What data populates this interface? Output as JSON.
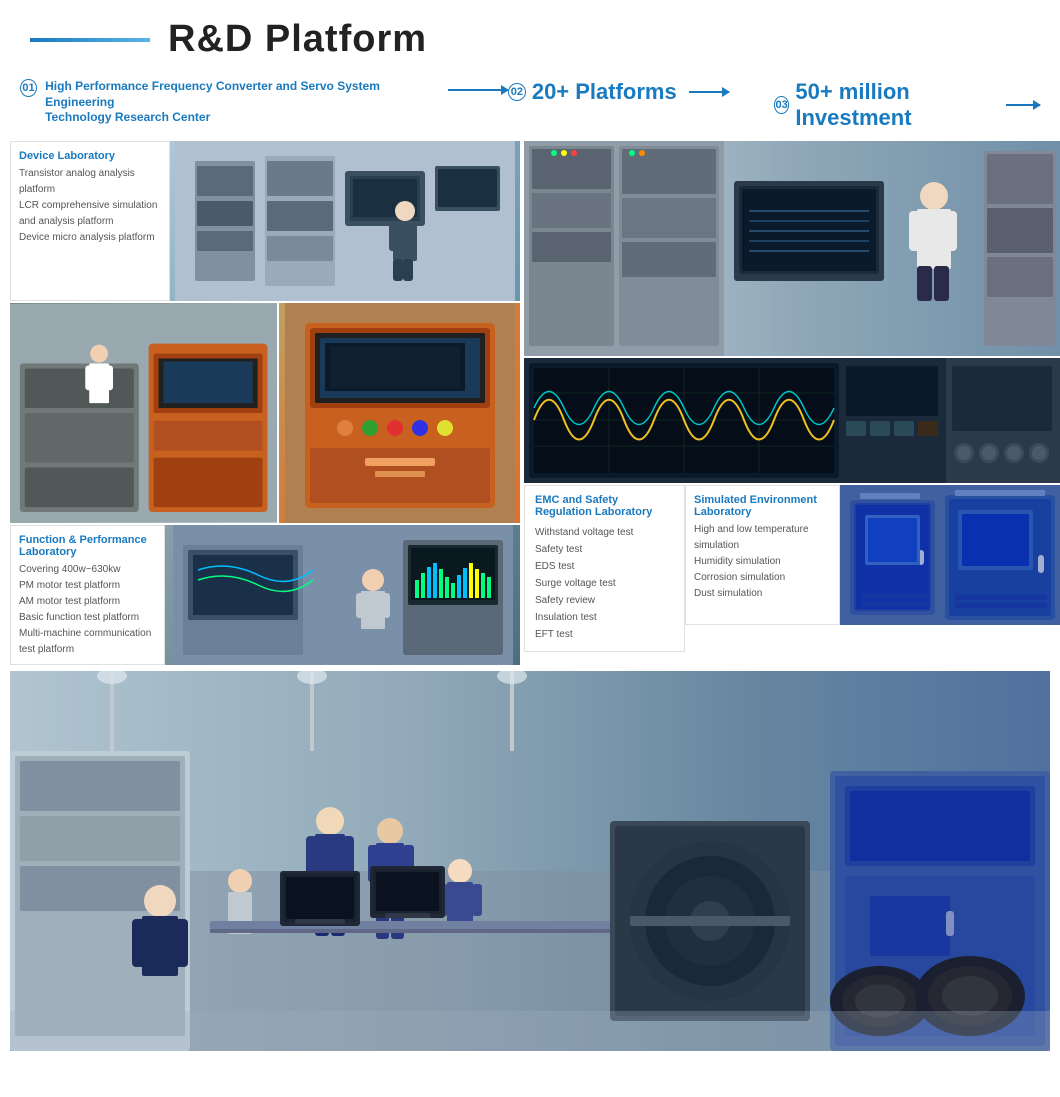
{
  "header": {
    "title": "R&D Platform",
    "line_decoration": true
  },
  "subtitle": {
    "item01": {
      "num": "01",
      "text_line1": "High Performance Frequency Converter and Servo System Engineering",
      "text_line2": "Technology Research Center"
    },
    "item02": {
      "num": "02",
      "label": "20+ Platforms"
    },
    "item03": {
      "num": "03",
      "label": "50+ million Investment"
    }
  },
  "device_lab": {
    "title": "Device Laboratory",
    "items": [
      "Transistor analog analysis platform",
      "LCR comprehensive simulation and analysis platform",
      "Device micro analysis platform"
    ]
  },
  "function_lab": {
    "title": "Function & Performance Laboratory",
    "items": [
      "Covering 400w~630kw",
      "PM motor test platform",
      "AM motor test platform",
      "Basic function test platform",
      "Multi-machine communication test platform"
    ]
  },
  "emc_lab": {
    "title": "EMC and Safety Regulation Laboratory",
    "items": [
      "Withstand voltage test",
      "Safety test",
      "EDS test",
      "Surge voltage test",
      "Safety review",
      "Insulation test",
      "EFT test"
    ]
  },
  "simulated_lab": {
    "title": "Simulated Environment Laboratory",
    "items": [
      "High and low temperature simulation",
      "Humidity simulation",
      "Corrosion simulation",
      "Dust simulation"
    ]
  },
  "colors": {
    "accent": "#1a7abf",
    "text_dark": "#222222",
    "text_gray": "#555555",
    "border": "#e0e0e0"
  }
}
